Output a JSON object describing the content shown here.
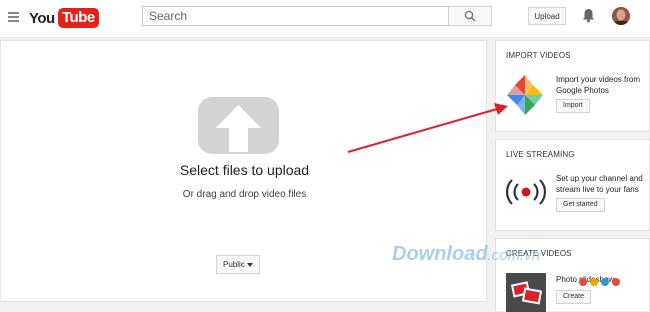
{
  "header": {
    "logo_you": "You",
    "logo_tube": "Tube",
    "search_placeholder": "Search",
    "upload_label": "Upload",
    "icons": [
      "menu-icon",
      "search-icon",
      "bell-icon"
    ]
  },
  "upload_area": {
    "title": "Select files to upload",
    "subtitle": "Or drag and drop video files",
    "privacy_value": "Public",
    "icon": "upload-arrow-icon"
  },
  "sidebar": {
    "import": {
      "title": "IMPORT VIDEOS",
      "text": "Import your videos from Google Photos",
      "button": "Import",
      "icon": "google-photos-icon"
    },
    "live": {
      "title": "LIVE STREAMING",
      "text": "Set up your channel and stream live to your fans",
      "button": "Get started",
      "icon": "live-broadcast-icon"
    },
    "create": {
      "title": "CREATE VIDEOS",
      "item_label": "Photo slideshow",
      "button": "Create",
      "icon": "photo-slideshow-thumbnail"
    }
  },
  "watermark": {
    "main": "Download",
    "suffix": ".com.vn",
    "dot_colors": [
      "#e24b3b",
      "#f2a200",
      "#3a8fd9",
      "#e24b3b"
    ]
  },
  "colors": {
    "brand_red": "#e62117",
    "annotation_arrow": "#d9232a",
    "live_red": "#cc181e"
  }
}
